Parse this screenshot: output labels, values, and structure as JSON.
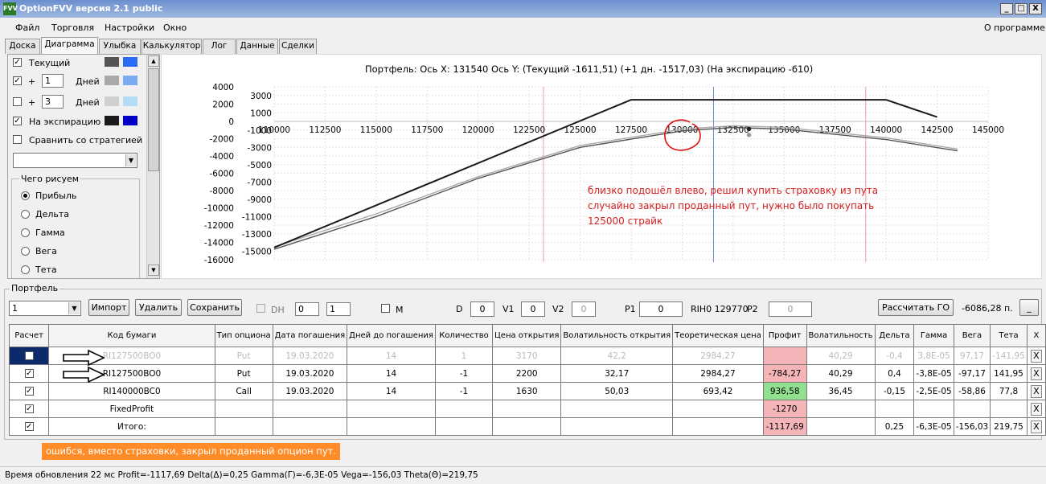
{
  "window": {
    "title": "OptionFVV версия 2.1 public",
    "icon": "app-icon",
    "controls": [
      "_",
      "□",
      "X"
    ]
  },
  "menu": {
    "items": [
      "Файл",
      "Торговля",
      "Настройки",
      "Окно"
    ],
    "about": "О программе"
  },
  "tabs": [
    "Доска",
    "Диаграмма",
    "Улыбка",
    "Калькулятор",
    "Лог",
    "Данные",
    "Сделки"
  ],
  "left": {
    "current_label": "Текущий",
    "plus": "+",
    "days_label": "Дней",
    "days1": "1",
    "days2": "3",
    "expiry_label": "На экспирацию",
    "compare_label": "Сравнить со стратегией",
    "group_label": "Чего рисуем",
    "radios": [
      "Прибыль",
      "Дельта",
      "Гамма",
      "Вега",
      "Тета"
    ],
    "swatches": {
      "current": [
        "#555555",
        "#2b6cf5"
      ],
      "d1": [
        "#a9a9a9",
        "#79aaf2"
      ],
      "d2": [
        "#cfcfcf",
        "#b3dcf6"
      ],
      "exp": [
        "#1a1a1a",
        "#0000c8"
      ]
    }
  },
  "chart_title": "Портфель: Ось X: 131540 Ось Y:  (Текущий -1611,51)  (+1 дн. -1517,03)  (На экспирацию -610)",
  "annotation": [
    "близко подошёл влево, решил купить страховку из пута",
    "случайно закрыл проданный пут, нужно было покупать",
    "125000 страйк"
  ],
  "chart_data": {
    "type": "line",
    "x_ticks": [
      "110000",
      "112500",
      "115000",
      "117500",
      "120000",
      "122500",
      "125000",
      "127500",
      "130000",
      "132500",
      "135000",
      "137500",
      "140000",
      "142500",
      "145000"
    ],
    "y_ticks_outer": [
      "4000",
      "2000",
      "0",
      "-2000",
      "-4000",
      "-6000",
      "-8000",
      "-10000",
      "-12000",
      "-14000",
      "-16000"
    ],
    "y_ticks_inner": [
      "3000",
      "1000",
      "-1000",
      "-3000",
      "-5000",
      "-7000",
      "-9000",
      "-11000",
      "-13000",
      "-15000"
    ],
    "xlim": [
      110000,
      145000
    ],
    "ylim": [
      -16000,
      4000
    ],
    "series": [
      {
        "x": [
          110000,
          127500,
          140000,
          142500
        ],
        "y": [
          -14600,
          2500,
          2500,
          500
        ],
        "color": "#1a1a1a"
      },
      {
        "x": [
          110000,
          115000,
          120000,
          125000,
          130000,
          132500,
          135000,
          140000,
          143500
        ],
        "y": [
          -14800,
          -11000,
          -6600,
          -3000,
          -1100,
          -700,
          -900,
          -2100,
          -3400
        ],
        "color": "#555555"
      },
      {
        "x": [
          110000,
          115000,
          120000,
          125000,
          130000,
          132500,
          135000,
          140000,
          143500
        ],
        "y": [
          -14500,
          -10700,
          -6400,
          -2800,
          -900,
          -500,
          -700,
          -1900,
          -3200
        ],
        "color": "#a9a9a9"
      }
    ],
    "vlines": [
      {
        "x": 131540,
        "color": "#6e8ec8"
      },
      {
        "x": 123200,
        "color": "#f0a0a8"
      },
      {
        "x": 139000,
        "color": "#f0a0a8"
      }
    ]
  },
  "portfolio": {
    "group_label": "Портфель",
    "select": "1",
    "import": "Импорт",
    "delete": "Удалить",
    "save": "Сохранить",
    "dh": "DH",
    "dh1": "0",
    "dh2": "1",
    "m": "M",
    "d_label": "D",
    "d_val": "0",
    "v1_label": "V1",
    "v1_val": "0",
    "v2_label": "V2",
    "v2_val": "0",
    "p1_label": "P1",
    "p1_val": "0",
    "rih": "RIH0 129770",
    "p2_label": "P2",
    "p2_val": "0",
    "calc": "Рассчитать ГО",
    "go_val": "-6086,28 п.",
    "min_btn": "_"
  },
  "table": {
    "headers": [
      "Расчет",
      "Код бумаги",
      "Тип опциона",
      "Дата погашения",
      "Дней до погашения",
      "Количество",
      "Цена открытия",
      "Волатильность открытия",
      "Теоретическая цена",
      "Профит",
      "Волатильность",
      "Дельта",
      "Гамма",
      "Вега",
      "Тета",
      "X"
    ],
    "rows": [
      {
        "check": "",
        "cells": [
          "RI127500BO0",
          "Put",
          "19.03.2020",
          "14",
          "1",
          "3170",
          "42,2",
          "2984,27",
          "",
          "40,29",
          "-0,4",
          "3,8E-05",
          "97,17",
          "-141,95",
          "X"
        ],
        "grey": true,
        "profit_color": "pink"
      },
      {
        "check": "✓",
        "cells": [
          "RI127500BO0",
          "Put",
          "19.03.2020",
          "14",
          "-1",
          "2200",
          "32,17",
          "2984,27",
          "-784,27",
          "40,29",
          "0,4",
          "-3,8E-05",
          "-97,17",
          "141,95",
          "X"
        ],
        "profit_color": "pink"
      },
      {
        "check": "✓",
        "cells": [
          "RI140000BC0",
          "Call",
          "19.03.2020",
          "14",
          "-1",
          "1630",
          "50,03",
          "693,42",
          "936,58",
          "36,45",
          "-0,15",
          "-2,5E-05",
          "-58,86",
          "77,8",
          "X"
        ],
        "profit_color": "green"
      },
      {
        "check": "✓",
        "cells": [
          "FixedProfit",
          "",
          "",
          "",
          "",
          "",
          "",
          "",
          "-1270",
          "",
          "",
          "",
          "",
          "",
          "X"
        ],
        "profit_color": "pink"
      },
      {
        "check": "✓",
        "cells": [
          "Итого:",
          "",
          "",
          "",
          "",
          "",
          "",
          "",
          "-1117,69",
          "",
          "0,25",
          "-6,3E-05",
          "-156,03",
          "219,75",
          "X"
        ],
        "profit_color": "pink"
      }
    ]
  },
  "note": "ошибся, вместо страховки, закрыл проданный опцион пут.",
  "status": "Время обновления 22 мс  Profit=-1117,69 Delta(Δ)=0,25 Gamma(Γ)=-6,3E-05 Vega=-156,03 Theta(Θ)=219,75"
}
